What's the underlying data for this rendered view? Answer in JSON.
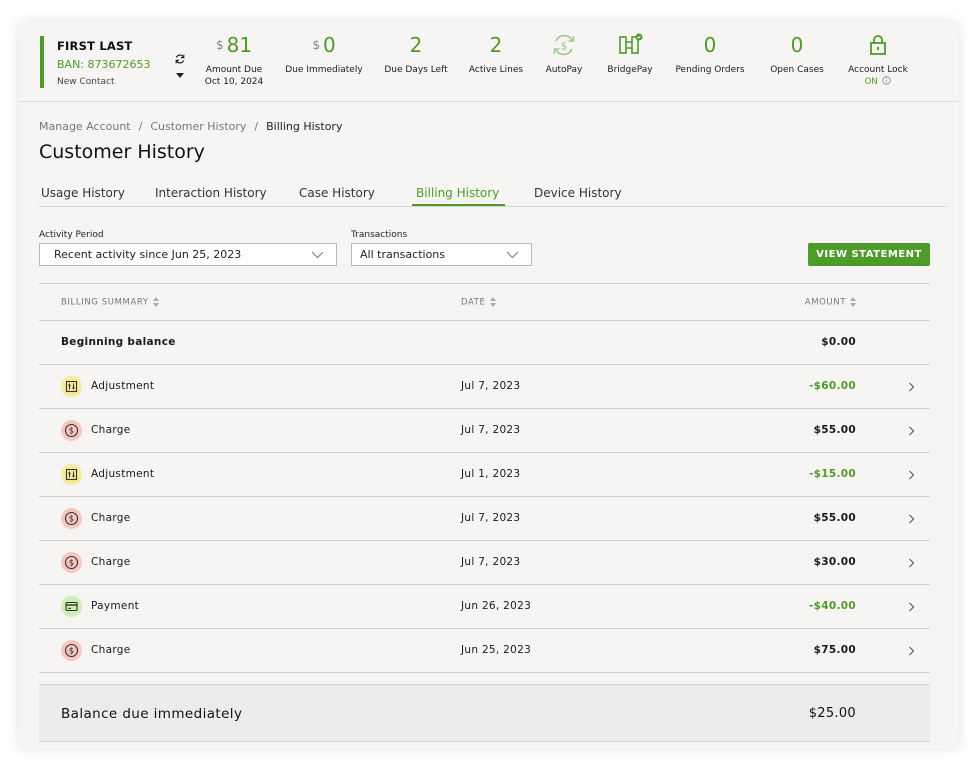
{
  "account": {
    "name": "FIRST LAST",
    "ban": "BAN: 873672653",
    "contact": "New Contact"
  },
  "stats": {
    "amount_due": {
      "currency": "$",
      "value": "81",
      "label": "Amount Due",
      "sub": "Oct 10, 2024"
    },
    "due_immediately": {
      "currency": "$",
      "value": "0",
      "label": "Due Immediately"
    },
    "due_days_left": {
      "value": "2",
      "label": "Due Days Left"
    },
    "active_lines": {
      "value": "2",
      "label": "Active Lines"
    },
    "autopay": {
      "label": "AutoPay",
      "icon": "autopay-dollar-icon"
    },
    "bridgepay": {
      "label": "BridgePay",
      "icon": "bridgepay-icon"
    },
    "pending_orders": {
      "value": "0",
      "label": "Pending Orders"
    },
    "open_cases": {
      "value": "0",
      "label": "Open Cases"
    },
    "account_lock": {
      "label": "Account Lock",
      "status": "ON",
      "icon": "lock-icon"
    }
  },
  "breadcrumb": {
    "items": [
      "Manage Account",
      "Customer History",
      "Billing History"
    ],
    "separator": "/"
  },
  "page_title": "Customer History",
  "tabs": [
    {
      "label": "Usage History",
      "active": false
    },
    {
      "label": "Interaction History",
      "active": false
    },
    {
      "label": "Case History",
      "active": false
    },
    {
      "label": "Billing History",
      "active": true
    },
    {
      "label": "Device History",
      "active": false
    }
  ],
  "filters": {
    "activity_period": {
      "label": "Activity Period",
      "value": "Recent activity since Jun 25, 2023"
    },
    "transactions": {
      "label": "Transactions",
      "value": "All transactions"
    },
    "view_statement": "VIEW STATEMENT"
  },
  "table": {
    "headers": {
      "summary": "BILLING SUMMARY",
      "date": "DATE",
      "amount": "AMOUNT"
    },
    "beginning": {
      "label": "Beginning balance",
      "amount": "$0.00"
    },
    "rows": [
      {
        "type": "Adjustment",
        "icon": "adjustment-icon",
        "date": "Jul 7, 2023",
        "amount": "-$60.00"
      },
      {
        "type": "Charge",
        "icon": "dollar-charge-icon",
        "date": "Jul 7, 2023",
        "amount": "$55.00"
      },
      {
        "type": "Adjustment",
        "icon": "adjustment-icon",
        "date": "Jul 1, 2023",
        "amount": "-$15.00"
      },
      {
        "type": "Charge",
        "icon": "dollar-charge-icon",
        "date": "Jul 7, 2023",
        "amount": "$55.00"
      },
      {
        "type": "Charge",
        "icon": "dollar-charge-icon",
        "date": "Jul 7, 2023",
        "amount": "$30.00"
      },
      {
        "type": "Payment",
        "icon": "card-payment-icon",
        "date": "Jun 26, 2023",
        "amount": "-$40.00"
      },
      {
        "type": "Charge",
        "icon": "dollar-charge-icon",
        "date": "Jun 25, 2023",
        "amount": "$75.00"
      }
    ]
  },
  "balance": {
    "label": "Balance due immediately",
    "amount": "$25.00"
  },
  "colors": {
    "accent": "#4e9a2a",
    "charge_badge": "#f7c6c1",
    "adjustment_badge": "#f6ec9b",
    "payment_badge": "#cdeeb5"
  }
}
